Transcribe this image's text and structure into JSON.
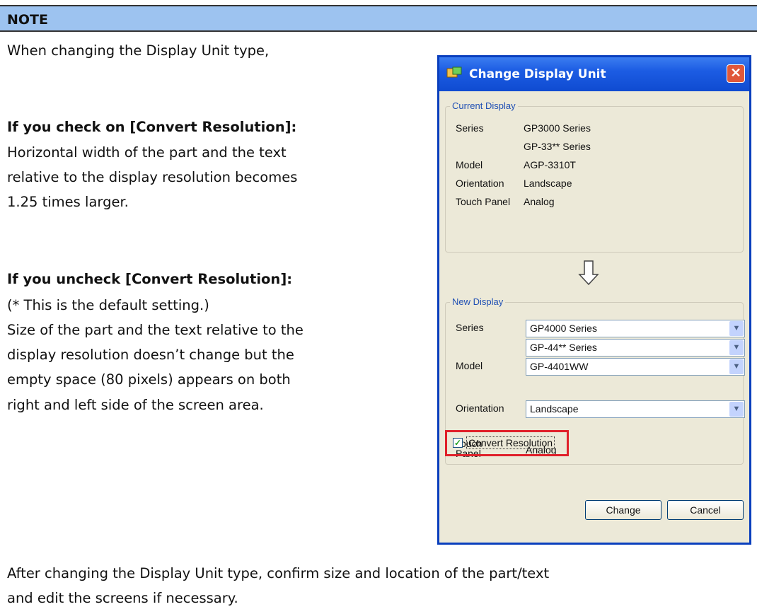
{
  "note": {
    "title": "NOTE"
  },
  "text": {
    "intro": "When changing the Display Unit type,",
    "check_heading": "If you check on [Convert Resolution]:",
    "check_body": [
      "Horizontal width of the part and the text",
      "relative to the display resolution becomes",
      "1.25 times larger."
    ],
    "uncheck_heading": "If you uncheck [Convert Resolution]:",
    "uncheck_body": [
      "(* This is the default setting.)",
      "Size of the part and the text relative to the",
      "display resolution doesn’t change but the",
      "empty space (80 pixels) appears on both",
      "right and left side of the screen area."
    ],
    "footer": [
      "After changing the Display Unit type, confirm size and location of the part/text",
      "and edit the screens if necessary."
    ]
  },
  "dialog": {
    "title": "Change Display Unit",
    "close_symbol": "✕",
    "current": {
      "group_label": "Current Display",
      "series_label": "Series",
      "series_value": "GP3000 Series",
      "subseries_value": "GP-33** Series",
      "model_label": "Model",
      "model_value": "AGP-3310T",
      "orientation_label": "Orientation",
      "orientation_value": "Landscape",
      "touch_label": "Touch Panel",
      "touch_value": "Analog"
    },
    "new": {
      "group_label": "New Display",
      "series_label": "Series",
      "series_value": "GP4000 Series",
      "subseries_value": "GP-44** Series",
      "model_label": "Model",
      "model_value": "GP-4401WW",
      "orientation_label": "Orientation",
      "orientation_value": "Landscape",
      "touch_label_line1": "Touch",
      "touch_label_line2": "Panel",
      "touch_value": "Analog"
    },
    "convert_resolution": {
      "label": "Convert Resolution",
      "checked": true
    },
    "change_button": "Change",
    "cancel_button": "Cancel",
    "dropdown_glyph": "▼"
  }
}
